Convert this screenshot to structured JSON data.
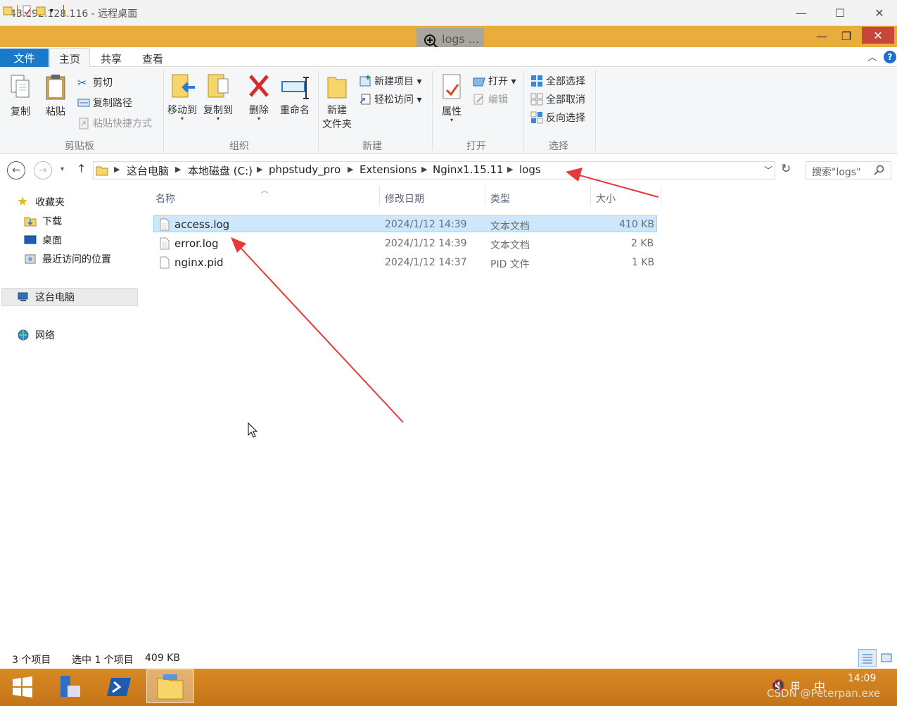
{
  "rdp": {
    "title": "43.192.128.116 - 远程桌面"
  },
  "explorer": {
    "tip_text": "logs ...",
    "tabs": [
      {
        "label": "文件"
      },
      {
        "label": "主页"
      },
      {
        "label": "共享"
      },
      {
        "label": "查看"
      }
    ],
    "ribbon": {
      "clipboard": {
        "group": "剪贴板",
        "copy": "复制",
        "paste": "粘贴",
        "cut": "剪切",
        "copy_path": "复制路径",
        "paste_shortcut": "粘贴快捷方式"
      },
      "organize": {
        "group": "组织",
        "move_to": "移动到",
        "copy_to": "复制到",
        "delete": "删除",
        "rename": "重命名"
      },
      "new": {
        "group": "新建",
        "new_folder_1": "新建",
        "new_folder_2": "文件夹",
        "new_item": "新建项目 ▾",
        "easy_access": "轻松访问 ▾"
      },
      "open": {
        "group": "打开",
        "properties": "属性",
        "open": "打开 ▾",
        "edit": "编辑"
      },
      "select": {
        "group": "选择",
        "select_all": "全部选择",
        "select_none": "全部取消",
        "invert": "反向选择"
      }
    },
    "breadcrumb": [
      "这台电脑",
      "本地磁盘 (C:)",
      "phpstudy_pro",
      "Extensions",
      "Nginx1.15.11",
      "logs"
    ],
    "search_placeholder": "搜索\"logs\"",
    "nav": {
      "favorites": "收藏夹",
      "downloads": "下载",
      "desktop": "桌面",
      "recent": "最近访问的位置",
      "this_pc": "这台电脑",
      "network": "网络"
    },
    "columns": {
      "name": "名称",
      "modified": "修改日期",
      "type": "类型",
      "size": "大小"
    },
    "files": [
      {
        "name": "access.log",
        "modified": "2024/1/12 14:39",
        "type": "文本文档",
        "size": "410 KB",
        "selected": true
      },
      {
        "name": "error.log",
        "modified": "2024/1/12 14:39",
        "type": "文本文档",
        "size": "2 KB",
        "selected": false
      },
      {
        "name": "nginx.pid",
        "modified": "2024/1/12 14:37",
        "type": "PID 文件",
        "size": "1 KB",
        "selected": false
      }
    ],
    "status": {
      "count": "3 个项目",
      "selected": "选中 1 个项目",
      "sel_size": "409 KB"
    }
  },
  "taskbar": {
    "time": "14:09",
    "ime": "中",
    "watermark": "CSDN @Peterpan.exe"
  },
  "colors": {
    "title_bar": "#e9ad3d",
    "file_tab": "#1979ca",
    "selection": "#cce8ff",
    "arrow": "#e53a3a",
    "taskbar": "#d98a24"
  }
}
